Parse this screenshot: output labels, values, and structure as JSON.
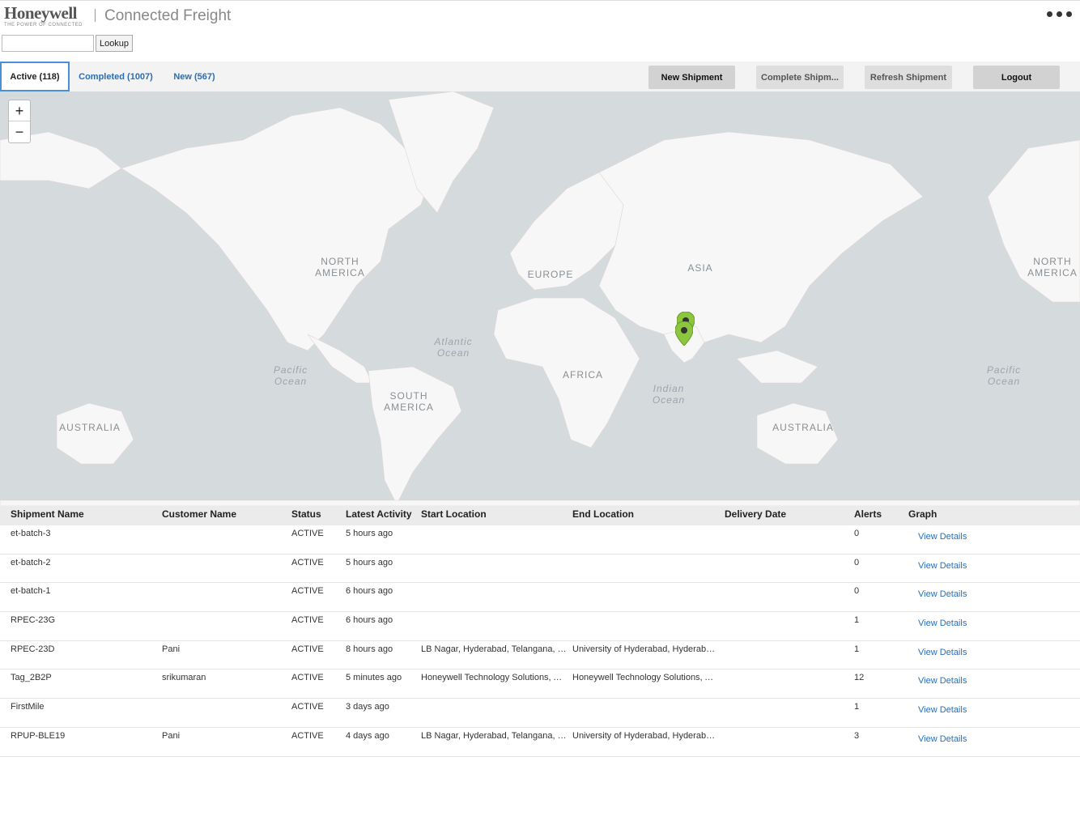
{
  "header": {
    "logo_text": "Honeywell",
    "logo_tagline": "THE POWER OF CONNECTED",
    "app_title": "Connected Freight",
    "more_icon": "ellipsis-icon"
  },
  "lookup": {
    "input_value": "",
    "button_label": "Lookup"
  },
  "tabs": [
    {
      "label": "Active (118)"
    },
    {
      "label": "Completed (1007)"
    },
    {
      "label": "New (567)"
    }
  ],
  "actions": {
    "new_shipment": "New Shipment",
    "complete_shipment": "Complete Shipm...",
    "refresh_shipment": "Refresh Shipment",
    "logout": "Logout"
  },
  "map": {
    "zoom_in": "+",
    "zoom_out": "−",
    "labels": {
      "north_america_w": "NORTH\nAMERICA",
      "north_america_e": "NORTH\nAMERICA",
      "europe": "EUROPE",
      "asia": "ASIA",
      "africa": "AFRICA",
      "south_america": "SOUTH\nAMERICA",
      "australia_w": "AUSTRALIA",
      "australia_e": "AUSTRALIA",
      "atlantic": "Atlantic\nOcean",
      "pacific_w": "Pacific\nOcean",
      "pacific_e": "Pacific\nOcean",
      "indian": "Indian\nOcean"
    },
    "marker_color": "#8cc63f"
  },
  "table": {
    "headers": [
      "Shipment Name",
      "Customer Name",
      "Status",
      "Latest Activity",
      "Start Location",
      "End Location",
      "Delivery Date",
      "Alerts",
      "Graph"
    ],
    "rows": [
      {
        "name": "et-batch-3",
        "customer": "",
        "status": "ACTIVE",
        "activity": "5 hours ago",
        "start": "",
        "end": "",
        "delivery": "",
        "alerts": "0",
        "graph": "View Details"
      },
      {
        "name": "et-batch-2",
        "customer": "",
        "status": "ACTIVE",
        "activity": "5 hours ago",
        "start": "",
        "end": "",
        "delivery": "",
        "alerts": "0",
        "graph": "View Details"
      },
      {
        "name": "et-batch-1",
        "customer": "",
        "status": "ACTIVE",
        "activity": "6 hours ago",
        "start": "",
        "end": "",
        "delivery": "",
        "alerts": "0",
        "graph": "View Details"
      },
      {
        "name": "RPEC-23G",
        "customer": "",
        "status": "ACTIVE",
        "activity": "6 hours ago",
        "start": "",
        "end": "",
        "delivery": "",
        "alerts": "1",
        "graph": "View Details"
      },
      {
        "name": "RPEC-23D",
        "customer": "Pani",
        "status": "ACTIVE",
        "activity": "8 hours ago",
        "start": "LB Nagar, Hyderabad, Telangana, India",
        "end": "University of Hyderabad, Hyderabad, T...",
        "delivery": "",
        "alerts": "1",
        "graph": "View Details"
      },
      {
        "name": "Tag_2B2P",
        "customer": "srikumaran",
        "status": "ACTIVE",
        "activity": "5 minutes ago",
        "start": "Honeywell Technology Solutions, Adar...",
        "end": "Honeywell Technology Solutions, Adar...",
        "delivery": "",
        "alerts": "12",
        "graph": "View Details"
      },
      {
        "name": "FirstMile",
        "customer": "",
        "status": "ACTIVE",
        "activity": "3 days ago",
        "start": "",
        "end": "",
        "delivery": "",
        "alerts": "1",
        "graph": "View Details"
      },
      {
        "name": "RPUP-BLE19",
        "customer": "Pani",
        "status": "ACTIVE",
        "activity": "4 days ago",
        "start": "LB Nagar, Hyderabad, Telangana, India",
        "end": "University of Hyderabad, Hyderabad, T...",
        "delivery": "",
        "alerts": "3",
        "graph": "View Details"
      }
    ]
  }
}
